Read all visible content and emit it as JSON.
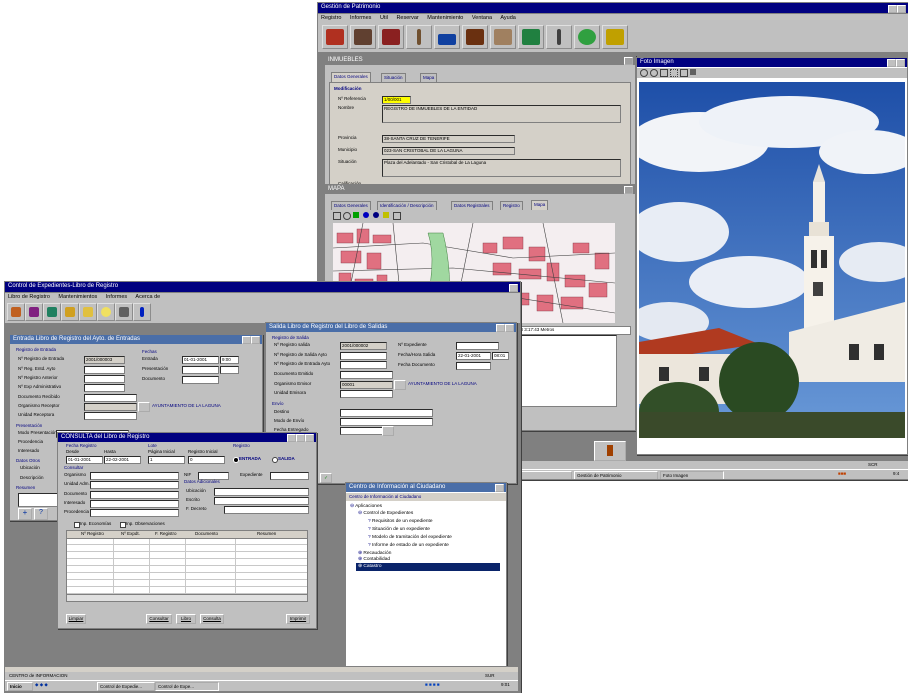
{
  "patrimonio": {
    "title": "Gestión de Patrimonio",
    "menu": [
      "Registro",
      "Informes",
      "Util",
      "Reservar",
      "Mantenimiento",
      "Ventana",
      "Ayuda"
    ],
    "inmuebles_panel": {
      "title": "INMUEBLES",
      "tabs": [
        "Datos Generales",
        "Situación",
        "Mapa"
      ],
      "section": "Modificación",
      "labels": [
        "Nº Referencia",
        "Nombre",
        "Provincia",
        "Municipio",
        "Situación",
        "Calificación"
      ],
      "values": {
        "referencia": "1/00/001",
        "nombre": "REGISTRO DE INMUEBLES DE LA ENTIDAD",
        "provincia": "38-SANTA CRUZ DE TENERIFE",
        "municipio": "023-SAN CRISTOBAL DE LA LAGUNA",
        "situacion": "Plaza del Adelantado - San Cristobal de La Laguna"
      }
    },
    "map_panel": {
      "title": "MAPA",
      "tabs": [
        "Datos Generales",
        "Identificación / Descripción",
        "Datos Registrales",
        "Registro",
        "Mapa"
      ],
      "coords": "3:00:08   3:17:43   Metros"
    },
    "photo_window": {
      "title": "Foto Imagen"
    }
  },
  "expedientes": {
    "title": "Control de Expedientes-Libro de Registro",
    "menu": [
      "Libro de Registro",
      "Mantenimientos",
      "Informes",
      "Acerca de"
    ],
    "entrada_panel": {
      "title": "Entrada Libro de Registro del Ayto. de Entradas",
      "group_registro": "Registro de Entrada",
      "group_fechas": "Fechas",
      "labels": [
        "Nº Registro de Entrada",
        "Nº Reg. Entd. Ayto",
        "Nº Registro Anterior",
        "Nº Exp Administrativo",
        "Documento Recibido",
        "Organismo Receptor",
        "Unidad Receptora"
      ],
      "fecha_labels": [
        "Entrada",
        "Presentación",
        "Documento"
      ],
      "values": {
        "registro": "2001/000003",
        "entrada": "01-01-2001",
        "hora": "9:00"
      },
      "org_text": "AYUNTAMIENTO DE LA LAGUNA",
      "group_presentacion": "Presentación",
      "pres_labels": [
        "Modo Presentación",
        "Procedencia",
        "Interesado"
      ],
      "group_datos": "Datos Otros",
      "datos_labels": [
        "Ubicación",
        "Descripción"
      ],
      "resumen": "Resumen"
    },
    "salida_panel": {
      "title": "Salida Libro de Registro del Libro de Salidas",
      "group": "Registro de Salida",
      "labels": [
        "Nº Registro salida",
        "Nº Registro de Salida Ayto",
        "Nº Registro de Entrada Ayto",
        "Documento Emitido",
        "Organismo Emisor",
        "Unidad Emisora"
      ],
      "right_labels": [
        "Nº Expediente",
        "Fecha/Hora Salida",
        "Fecha Documento"
      ],
      "values": {
        "salida": "2001/000002",
        "fecha": "22-01-2001",
        "hora": "08:01",
        "org_code": "00001"
      },
      "org_text": "AYUNTAMIENTO DE LA LAGUNA",
      "group_envio": "Envío",
      "envio_labels": [
        "Destino",
        "Modo de Envío",
        "Fecha Entregado"
      ]
    },
    "consulta": {
      "title": "CONSULTA del Libro de Registro",
      "col_labels": [
        "Fecha Registro",
        "Lote",
        "Registro"
      ],
      "sub_labels": [
        "Desde",
        "Hasta",
        "Página Inicial",
        "Registro Inicial"
      ],
      "values": {
        "desde": "01-01-2001",
        "hasta": "22-02-2001",
        "pagina": "1",
        "registro": "0"
      },
      "radio_entrada": "ENTRADA",
      "radio_salida": "SALIDA",
      "nif_label": "NIF",
      "exp_label": "Expediente",
      "group_consultar": "Consultar",
      "consultar_labels": [
        "Organismo",
        "Unidad Adm.",
        "Documento",
        "Interesado",
        "Procedencia"
      ],
      "group_datos": "Datos Adicionales",
      "datos_labels": [
        "Ubicación",
        "Escrito",
        "F. Decreto"
      ],
      "checks": [
        "Inp. Economías",
        "Inp. Observaciones"
      ],
      "columns": [
        "Nº Registro",
        "Nº Expdt.",
        "F. Registro",
        "Documento",
        "Resumen"
      ],
      "buttons": {
        "limpiar": "Limpiar",
        "consultar": "Consultar",
        "libro": "Libro",
        "consulta": "Consulta",
        "imprimir": "Imprimir"
      }
    },
    "centro": {
      "title": "Centro de Información al Ciudadano",
      "subtitle": "Centro de Información al Ciudadano",
      "tree": [
        {
          "label": "Aplicaciones",
          "level": 0
        },
        {
          "label": "Control de Expedientes",
          "level": 1
        },
        {
          "label": "Requisitos de un expediente",
          "level": 2
        },
        {
          "label": "Situación de un expediente",
          "level": 2
        },
        {
          "label": "Modelo de tramitación del expediente",
          "level": 2
        },
        {
          "label": "Informe de estado de un expediente",
          "level": 2
        },
        {
          "label": "Recaudación",
          "level": 1
        },
        {
          "label": "Contabilidad",
          "level": 1
        },
        {
          "label": "Catastro",
          "level": 1
        }
      ]
    },
    "statusbar": {
      "left": "CENTRO de INFORMACION",
      "right": "SUR"
    }
  },
  "taskbar_bottom": {
    "start": "Inicio",
    "items": [
      "Control de Expedie...",
      "Control de Expe..."
    ],
    "clock": "9:01"
  },
  "taskbar_top": {
    "items": [
      "Paint Shop Pro - [Ima...",
      "Gestión de Patrimonio",
      "Foto Imagen"
    ],
    "status": "SCR",
    "clock": "9:4"
  }
}
